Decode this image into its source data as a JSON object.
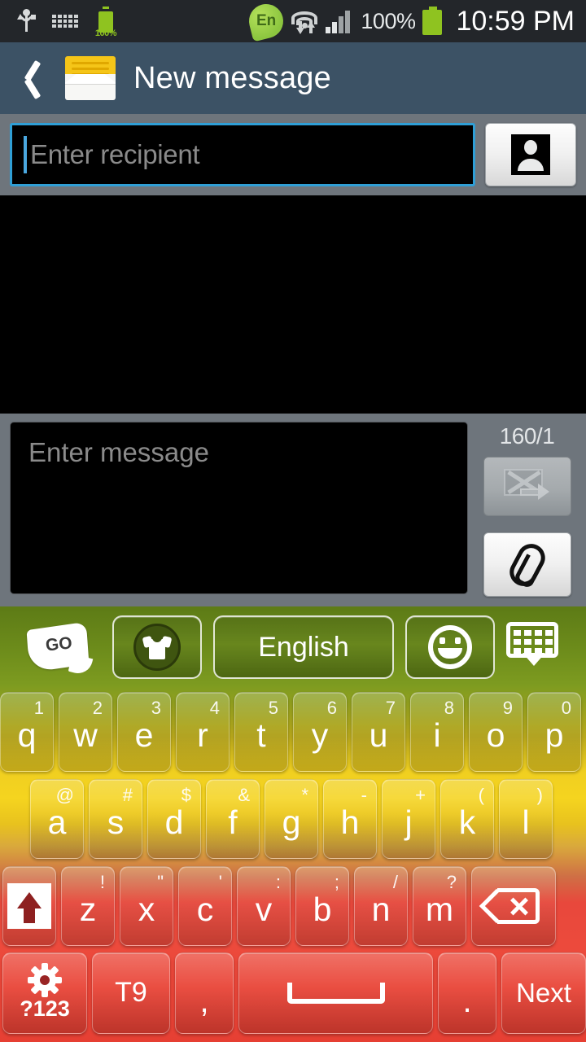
{
  "status_bar": {
    "usb_icon": "usb-icon",
    "keyboard_icon": "keyboard-icon",
    "battery_small_percent": "100%",
    "language_badge": "En",
    "wifi_icon": "wifi-icon",
    "signal_icon": "signal-bars-icon",
    "battery_percent": "100%",
    "time": "10:59 PM"
  },
  "title_bar": {
    "back_icon": "back-chevron-icon",
    "app_icon": "envelope-icon",
    "title": "New message"
  },
  "recipient": {
    "placeholder": "Enter recipient",
    "value": "",
    "contacts_icon": "contacts-person-icon"
  },
  "compose": {
    "placeholder": "Enter message",
    "value": "",
    "counter": "160/1",
    "send_icon": "send-message-icon",
    "send_enabled": false,
    "attach_icon": "paperclip-icon"
  },
  "keyboard": {
    "toolbar": {
      "logo": "go-keyboard-logo",
      "theme_icon": "tshirt-theme-icon",
      "language": "English",
      "emoji_icon": "smiley-emoji-icon",
      "hide_icon": "hide-keyboard-icon"
    },
    "row1": [
      {
        "main": "q",
        "sub": "1"
      },
      {
        "main": "w",
        "sub": "2"
      },
      {
        "main": "e",
        "sub": "3"
      },
      {
        "main": "r",
        "sub": "4"
      },
      {
        "main": "t",
        "sub": "5"
      },
      {
        "main": "y",
        "sub": "6"
      },
      {
        "main": "u",
        "sub": "7"
      },
      {
        "main": "i",
        "sub": "8"
      },
      {
        "main": "o",
        "sub": "9"
      },
      {
        "main": "p",
        "sub": "0"
      }
    ],
    "row2": [
      {
        "main": "a",
        "sub": "@"
      },
      {
        "main": "s",
        "sub": "#"
      },
      {
        "main": "d",
        "sub": "$"
      },
      {
        "main": "f",
        "sub": "&"
      },
      {
        "main": "g",
        "sub": "*"
      },
      {
        "main": "h",
        "sub": "-"
      },
      {
        "main": "j",
        "sub": "+"
      },
      {
        "main": "k",
        "sub": "("
      },
      {
        "main": "l",
        "sub": ")"
      }
    ],
    "row3": [
      {
        "main": "z",
        "sub": "!"
      },
      {
        "main": "x",
        "sub": "\""
      },
      {
        "main": "c",
        "sub": "'"
      },
      {
        "main": "v",
        "sub": ":"
      },
      {
        "main": "b",
        "sub": ";"
      },
      {
        "main": "n",
        "sub": "/"
      },
      {
        "main": "m",
        "sub": "?"
      }
    ],
    "shift_icon": "shift-key-icon",
    "backspace_icon": "backspace-key-icon",
    "row4": {
      "symbols_label": "?123",
      "symbols_icon": "gear-icon",
      "t9_label": "T9",
      "comma_label": ",",
      "space_icon": "space-bar-icon",
      "period_label": ".",
      "next_label": "Next"
    }
  },
  "colors": {
    "title_bar": "#3c5265",
    "panel": "#6e757c",
    "focus_border": "#2f9fd6",
    "accent_green": "#8cc63f",
    "kb_green": "#6d8c1b",
    "kb_yellow": "#f0cf20",
    "kb_red": "#e63f33"
  }
}
